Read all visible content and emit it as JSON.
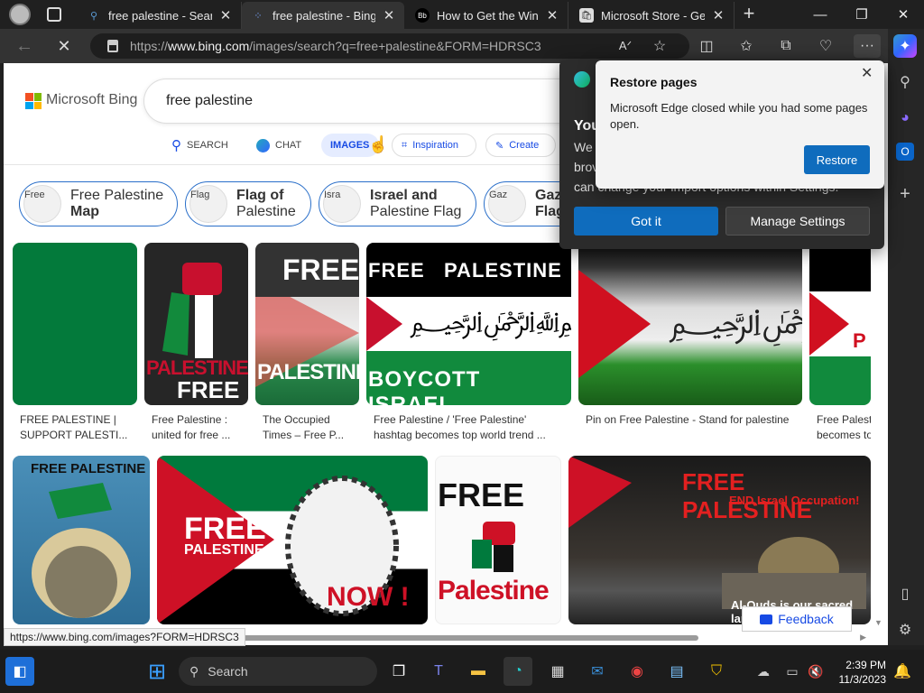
{
  "tabs": [
    {
      "title": "free palestine - Search",
      "icon": "search-icon"
    },
    {
      "title": "free palestine - Bing im",
      "icon": "bing-images-icon"
    },
    {
      "title": "How to Get the Windo",
      "icon": "bb-icon"
    },
    {
      "title": "Microsoft Store - Gene",
      "icon": "store-icon"
    }
  ],
  "address": {
    "prefix": "https://",
    "domain": "www.bing.com",
    "path": "/images/search?q=free+palestine&FORM=HDRSC3"
  },
  "bing": {
    "logo_text": "Microsoft Bing",
    "query": "free palestine"
  },
  "nav": {
    "search": "SEARCH",
    "chat": "CHAT",
    "images": "IMAGES",
    "inspiration": "Inspiration",
    "create": "Create"
  },
  "chips": [
    {
      "alt": "Free",
      "line1": "Free Palestine",
      "line2": "Map"
    },
    {
      "alt": "Flag",
      "line1": "Flag of",
      "line2": "Palestine"
    },
    {
      "alt": "Isra",
      "line1": "Israel and",
      "line2": "Palestine Flag"
    },
    {
      "alt": "Gaz",
      "line1": "Gaz",
      "line2": "Flag"
    }
  ],
  "results_row1": [
    {
      "caption1": "FREE PALESTINE |",
      "caption2": "SUPPORT PALESTI..."
    },
    {
      "caption1": "Free Palestine :",
      "caption2": "united for free ..."
    },
    {
      "caption1": "The Occupied",
      "caption2": "Times – Free P..."
    },
    {
      "caption1": "Free Palestine / 'Free Palestine'",
      "caption2": "hashtag becomes top world trend ..."
    },
    {
      "caption1": "Pin on Free Palestine - Stand for palestine",
      "caption2": ""
    },
    {
      "caption1": "Free Palest",
      "caption2": "becomes to"
    }
  ],
  "image_text": {
    "palestine_free_1": "PALESTINE",
    "palestine_free_2": "FREE",
    "free": "FREE",
    "palestine": "PALESTINE",
    "banner_top": "FREE   PALESTINE",
    "banner_bottom": "BOYCOTT ISRAEL",
    "poster_title": "FREE PALESTINE",
    "free_palestine_now_1": "FREE",
    "free_palestine_now_2": "PALESTINE",
    "now": "NOW !",
    "fist_free": "FREE",
    "fist_palestine": "Palestine",
    "aqsa_title": "FREE PALESTINE",
    "aqsa_sub": "END Israel Occupation!",
    "aqsa_bottom": "Al-Quds is our sacred land!",
    "p": "P"
  },
  "feedback": "Feedback",
  "status_url": "https://www.bing.com/images?FORM=HDRSC3",
  "popup": {
    "bg_title": "You",
    "bg_text1": "We",
    "bg_text2": "brov",
    "bg_text3": "can change your import options within Settings.",
    "got_it": "Got it",
    "manage": "Manage Settings",
    "restore_title": "Restore pages",
    "restore_text": "Microsoft Edge closed while you had some pages open.",
    "restore_button": "Restore"
  },
  "taskbar": {
    "search": "Search",
    "time": "2:39 PM",
    "date": "11/3/2023"
  },
  "colors": {
    "accent": "#0f6cbd",
    "flag_green": "#007a3d",
    "flag_red": "#ce1126"
  }
}
